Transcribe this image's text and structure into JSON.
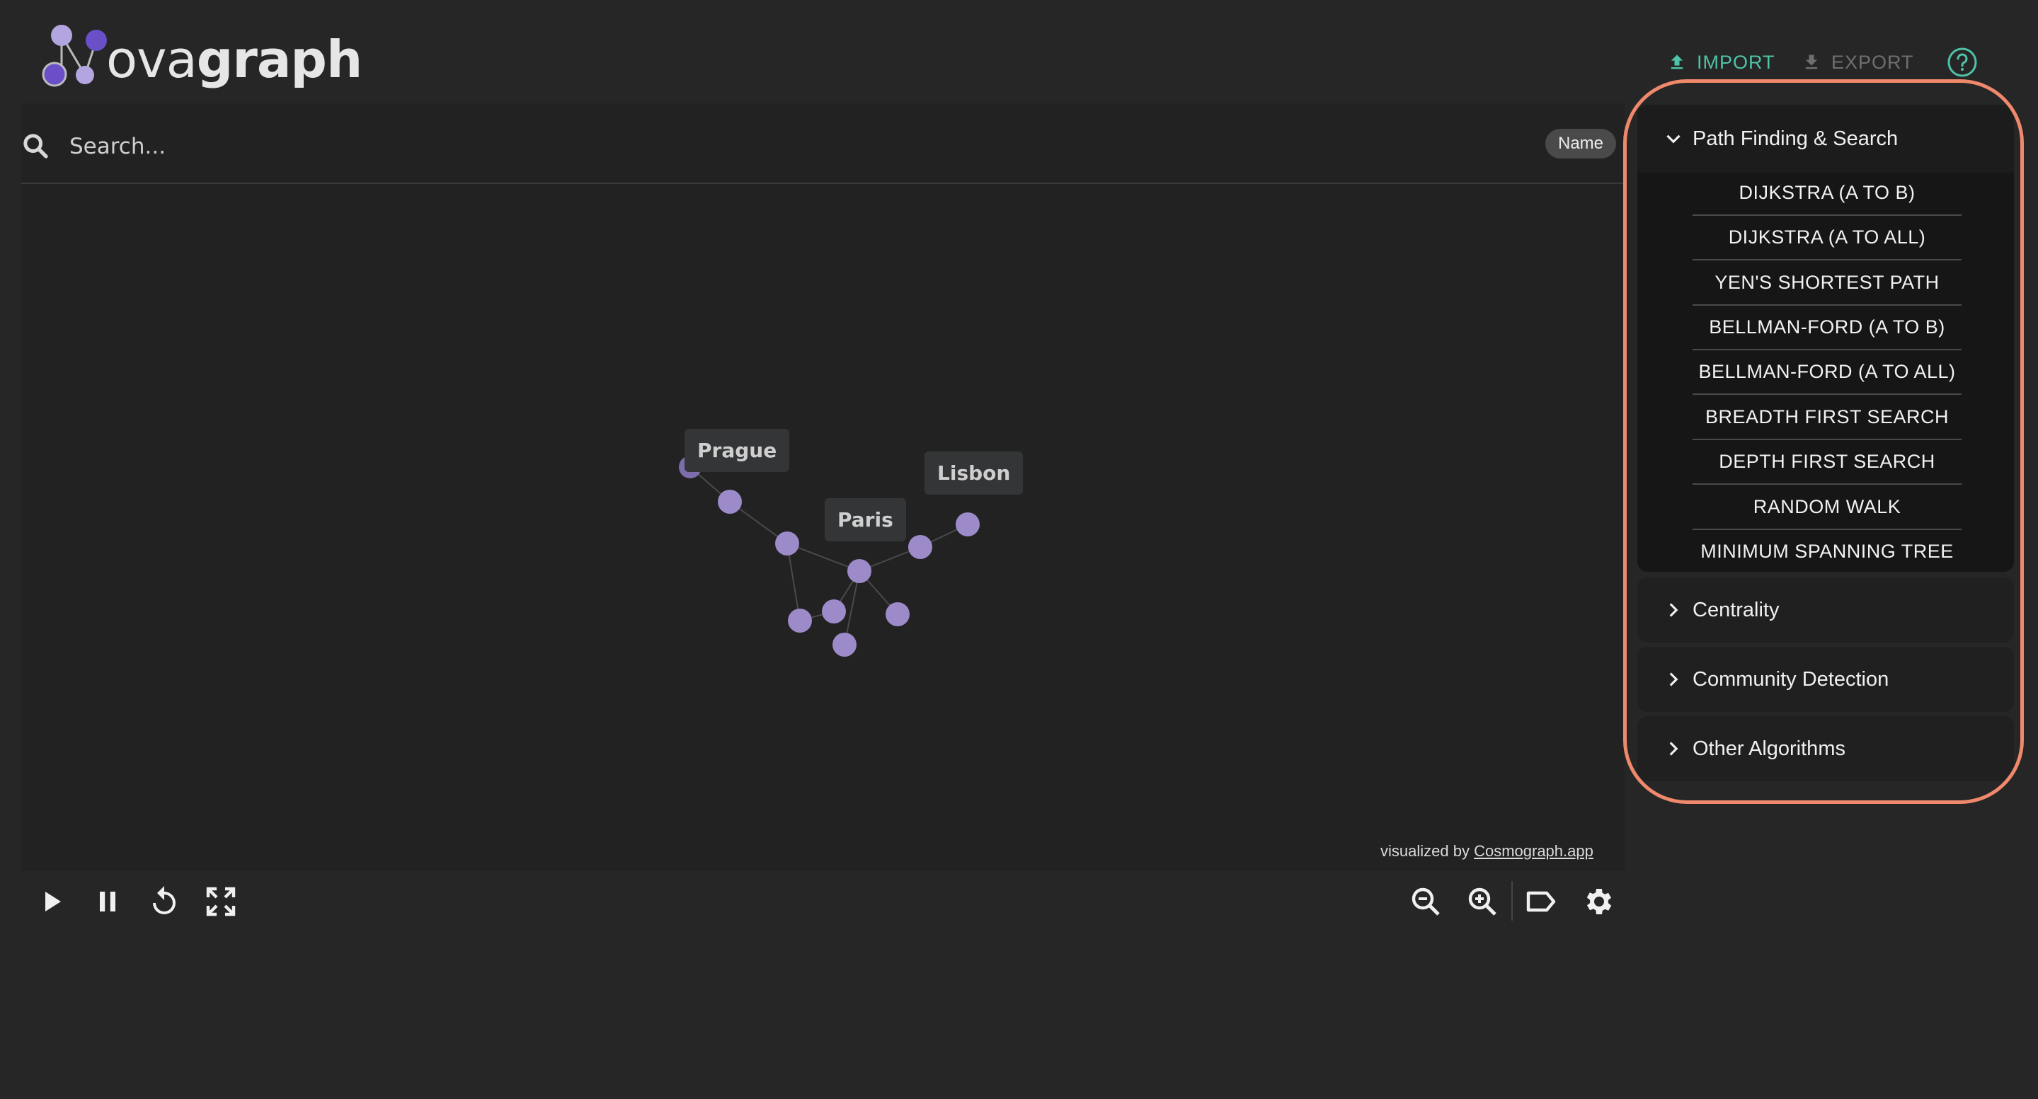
{
  "app": {
    "logo_text_light": "ova",
    "logo_text_bold": "graph"
  },
  "header": {
    "import_label": "IMPORT",
    "export_label": "EXPORT",
    "import_color": "#4fc3a8",
    "export_color": "#6f6f6f"
  },
  "search": {
    "placeholder": "Search...",
    "value": "",
    "field_chip": "Name"
  },
  "graph": {
    "node_color": "#9d8ac9",
    "labels": {
      "prague": "Prague",
      "paris": "Paris",
      "lisbon": "Lisbon"
    },
    "credit_prefix": "visualized by ",
    "credit_link": "Cosmograph.app"
  },
  "toolbar": {
    "left": [
      "play-icon",
      "pause-icon",
      "restart-icon",
      "fit-view-icon"
    ],
    "right": [
      "zoom-out-icon",
      "zoom-in-icon",
      "label-icon",
      "settings-icon"
    ]
  },
  "algorithms": {
    "sections": [
      {
        "title": "Path Finding & Search",
        "expanded": true,
        "items": [
          "DIJKSTRA (A TO B)",
          "DIJKSTRA (A TO ALL)",
          "YEN'S SHORTEST PATH",
          "BELLMAN-FORD (A TO B)",
          "BELLMAN-FORD (A TO ALL)",
          "BREADTH FIRST SEARCH",
          "DEPTH FIRST SEARCH",
          "RANDOM WALK",
          "MINIMUM SPANNING TREE"
        ]
      },
      {
        "title": "Centrality",
        "expanded": false
      },
      {
        "title": "Community Detection",
        "expanded": false
      },
      {
        "title": "Other Algorithms",
        "expanded": false
      }
    ],
    "highlight_color": "#f0896c"
  }
}
